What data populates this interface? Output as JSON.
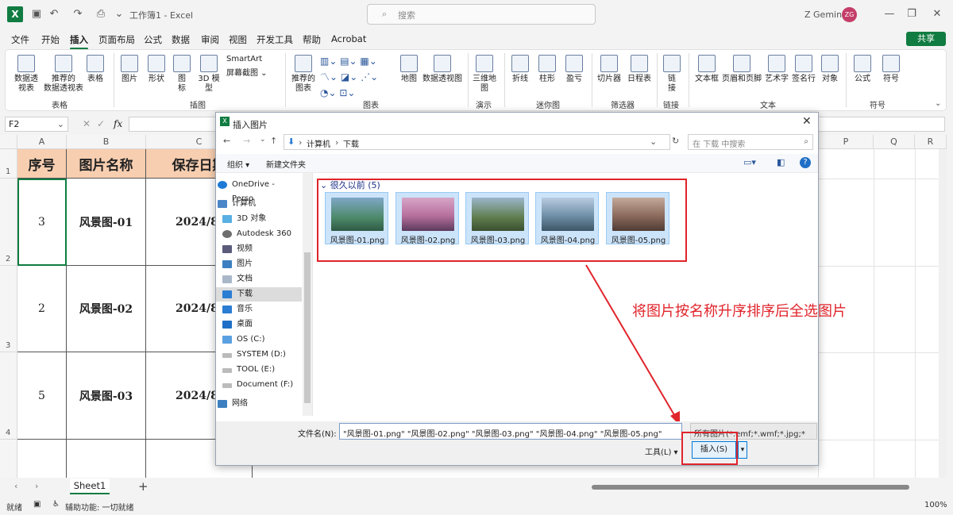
{
  "titlebar": {
    "doc_title": "工作簿1 - Excel",
    "search_placeholder": "搜索",
    "user_name": "Z Gemini",
    "avatar": "ZG"
  },
  "menu": [
    "文件",
    "开始",
    "插入",
    "页面布局",
    "公式",
    "数据",
    "审阅",
    "视图",
    "开发工具",
    "帮助",
    "Acrobat"
  ],
  "share": "共享",
  "ribbon": {
    "buttons": [
      {
        "label": "数据透\n视表",
        "icon": "pivot-table-icon"
      },
      {
        "label": "推荐的\n数据透视表",
        "icon": "recommended-pivot-icon"
      },
      {
        "label": "表格",
        "icon": "table-icon"
      },
      {
        "label": "图片",
        "icon": "picture-icon"
      },
      {
        "label": "形状",
        "icon": "shapes-icon"
      },
      {
        "label": "图\n标",
        "icon": "icons-icon"
      },
      {
        "label": "3D 模\n型",
        "icon": "3d-model-icon"
      },
      {
        "label": "推荐的\n图表",
        "icon": "recommended-charts-icon"
      },
      {
        "label": "地图",
        "icon": "map-icon"
      },
      {
        "label": "数据透视图",
        "icon": "pivot-chart-icon"
      },
      {
        "label": "三维地\n图",
        "icon": "3d-map-icon"
      },
      {
        "label": "折线",
        "icon": "sparkline-line-icon"
      },
      {
        "label": "柱形",
        "icon": "sparkline-column-icon"
      },
      {
        "label": "盈亏",
        "icon": "sparkline-winloss-icon"
      },
      {
        "label": "切片器",
        "icon": "slicer-icon"
      },
      {
        "label": "日程表",
        "icon": "timeline-icon"
      },
      {
        "label": "链\n接",
        "icon": "link-icon"
      },
      {
        "label": "文本框",
        "icon": "textbox-icon"
      },
      {
        "label": "页眉和页脚",
        "icon": "header-footer-icon"
      },
      {
        "label": "艺术字",
        "icon": "wordart-icon"
      },
      {
        "label": "签名行",
        "icon": "signature-icon"
      },
      {
        "label": "对象",
        "icon": "object-icon"
      },
      {
        "label": "公式",
        "icon": "equation-icon"
      },
      {
        "label": "符号",
        "icon": "symbol-icon"
      }
    ],
    "smartart": "SmartArt",
    "screenshot": "屏幕截图",
    "groups": [
      "表格",
      "插图",
      "图表",
      "演示",
      "迷你图",
      "筛选器",
      "链接",
      "文本",
      "符号"
    ]
  },
  "formula": {
    "namebox": "F2",
    "fx": "fx"
  },
  "columns": [
    "A",
    "B",
    "C",
    "P",
    "Q",
    "R"
  ],
  "rows": [
    "1",
    "2",
    "3",
    "4"
  ],
  "table": {
    "headers": [
      "序号",
      "图片名称",
      "保存日期"
    ],
    "rows": [
      {
        "no": "3",
        "name": "风景图-01",
        "date": "2024/8/"
      },
      {
        "no": "2",
        "name": "风景图-02",
        "date": "2024/8/"
      },
      {
        "no": "5",
        "name": "风景图-03",
        "date": "2024/8/"
      }
    ]
  },
  "sheet_tab": "Sheet1",
  "status": {
    "ready": "就绪",
    "accessibility": "辅助功能: 一切就绪",
    "zoom": "100%"
  },
  "dialog": {
    "title": "插入图片",
    "path": [
      "计算机",
      "下载"
    ],
    "search_placeholder": "在 下载 中搜索",
    "organize": "组织",
    "new_folder": "新建文件夹",
    "nav": [
      "OneDrive - Perso",
      "计算机",
      "3D 对象",
      "Autodesk 360",
      "视频",
      "图片",
      "文档",
      "下载",
      "音乐",
      "桌面",
      "OS (C:)",
      "SYSTEM (D:)",
      "TOOL (E:)",
      "Document (F:)",
      "网络"
    ],
    "group_header": "很久以前 (5)",
    "files": [
      {
        "name": "风景图-01.png",
        "color": "#4d8a6a"
      },
      {
        "name": "风景图-02.png",
        "color": "#b76f9c"
      },
      {
        "name": "风景图-03.png",
        "color": "#5f7d4e"
      },
      {
        "name": "风景图-04.png",
        "color": "#6e8fa7"
      },
      {
        "name": "风景图-05.png",
        "color": "#8b6a5c"
      }
    ],
    "filename_label": "文件名(N):",
    "filename_value": "\"风景图-01.png\" \"风景图-02.png\" \"风景图-03.png\" \"风景图-04.png\" \"风景图-05.png\"",
    "filetype": "所有图片(*.emf;*.wmf;*.jpg;*",
    "tools": "工具(L)",
    "insert": "插入(S)"
  },
  "annotation": "将图片按名称升序排序后全选图片",
  "accent": "#107c41",
  "annotation_color": "#e0242b"
}
